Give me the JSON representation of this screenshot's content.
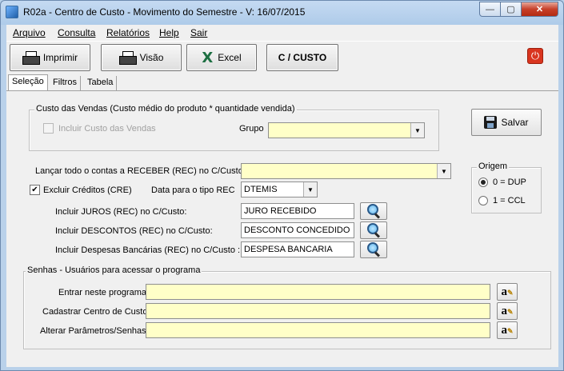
{
  "window": {
    "title": "R02a - Centro de Custo - Movimento do Semestre - V: 16/07/2015",
    "min_glyph": "—",
    "max_glyph": "▢",
    "close_glyph": "✕"
  },
  "menu": [
    "Arquivo",
    "Consulta",
    "Relatórios",
    "Help",
    "Sair"
  ],
  "toolbar": {
    "imprimir": "Imprimir",
    "visao": "Visão",
    "excel": "Excel",
    "excel_glyph": "X",
    "ccusto": "C / CUSTO",
    "power_glyph": "⏻"
  },
  "tabs": [
    "Seleção",
    "Filtros",
    "Tabela"
  ],
  "custo_vendas": {
    "group_title": "Custo das Vendas (Custo médio do produto * quantidade vendida)",
    "incluir_label": "Incluir Custo das Vendas",
    "incluir_checked": false,
    "grupo_label": "Grupo",
    "grupo_value": ""
  },
  "salvar_label": "Salvar",
  "receber": {
    "label": "Lançar todo o contas a RECEBER (REC) no C/Custo",
    "value": ""
  },
  "excluir_creditos": {
    "label": "Excluir Créditos (CRE)",
    "checked": true,
    "check_glyph": "✔"
  },
  "data_tipo_rec": {
    "label": "Data para o tipo REC",
    "value": "DTEMIS"
  },
  "juros": {
    "label": "Incluir JUROS (REC) no C/Custo:",
    "value": "JURO RECEBIDO"
  },
  "descontos": {
    "label": "Incluir DESCONTOS (REC) no C/Custo:",
    "value": "DESCONTO CONCEDIDO"
  },
  "despesas": {
    "label": "Incluir Despesas Bancárias  (REC) no C/Custo :",
    "value": "DESPESA BANCARIA"
  },
  "origem": {
    "title": "Origem",
    "options": [
      "0 = DUP",
      "1 = CCL"
    ],
    "selected": "0 = DUP"
  },
  "senhas": {
    "group_title": "Senhas - Usuários para acessar o programa",
    "rows": [
      {
        "label": "Entrar neste programa",
        "value": ""
      },
      {
        "label": "Cadastrar Centro de Custo",
        "value": ""
      },
      {
        "label": "Alterar Parâmetros/Senhas",
        "value": ""
      }
    ],
    "edit_glyph": "a"
  },
  "dropdown_glyph": "▼"
}
